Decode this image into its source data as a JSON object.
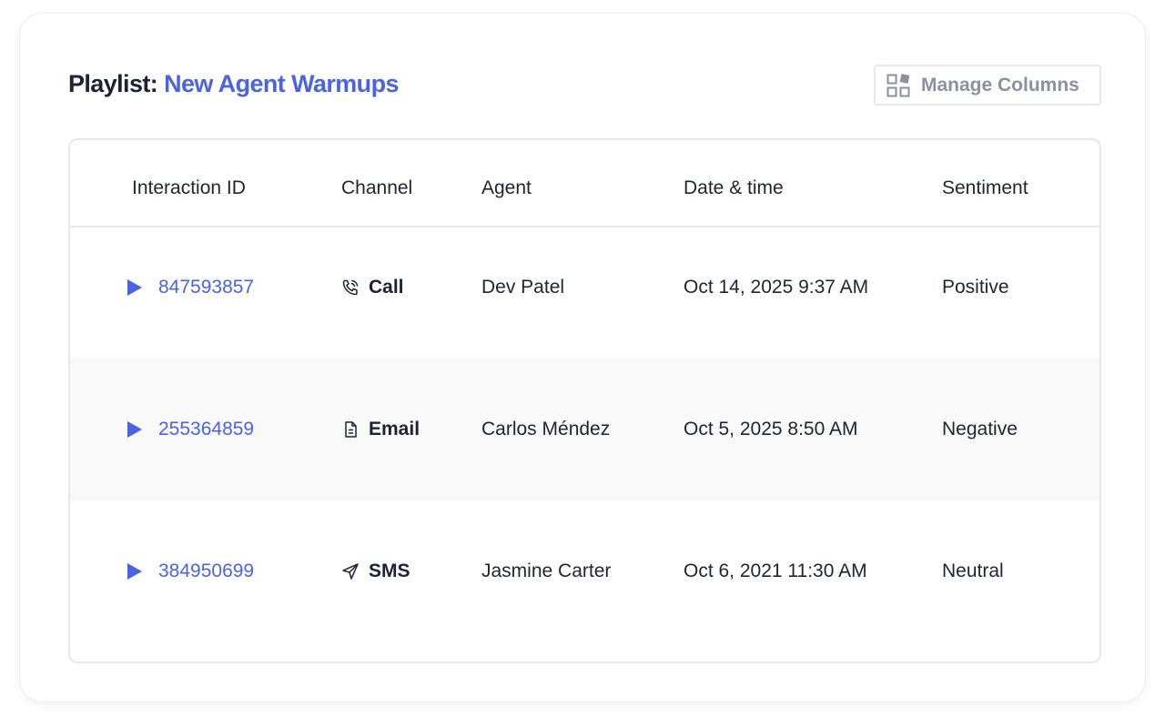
{
  "header": {
    "prefix": "Playlist:",
    "playlist_name": "New Agent Warmups"
  },
  "toolbar": {
    "manage_columns_label": "Manage Columns",
    "manage_columns_icon": "columns-grid-icon"
  },
  "table": {
    "columns": [
      "Interaction ID",
      "Channel",
      "Agent",
      "Date & time",
      "Sentiment"
    ],
    "rows": [
      {
        "id": "847593857",
        "channel": "Call",
        "channel_icon": "phone-icon",
        "agent": "Dev Patel",
        "datetime": "Oct 14, 2025 9:37 AM",
        "sentiment": "Positive"
      },
      {
        "id": "255364859",
        "channel": "Email",
        "channel_icon": "document-icon",
        "agent": "Carlos Méndez",
        "datetime": "Oct 5, 2025 8:50 AM",
        "sentiment": "Negative"
      },
      {
        "id": "384950699",
        "channel": "SMS",
        "channel_icon": "send-icon",
        "agent": "Jasmine Carter",
        "datetime": "Oct 6, 2021 11:30 AM",
        "sentiment": "Neutral"
      }
    ]
  },
  "colors": {
    "accent": "#4a63e6",
    "text": "#1f2430",
    "muted": "#8b919d",
    "border": "#e6e8ec",
    "row_alt": "#f9f9fa"
  }
}
